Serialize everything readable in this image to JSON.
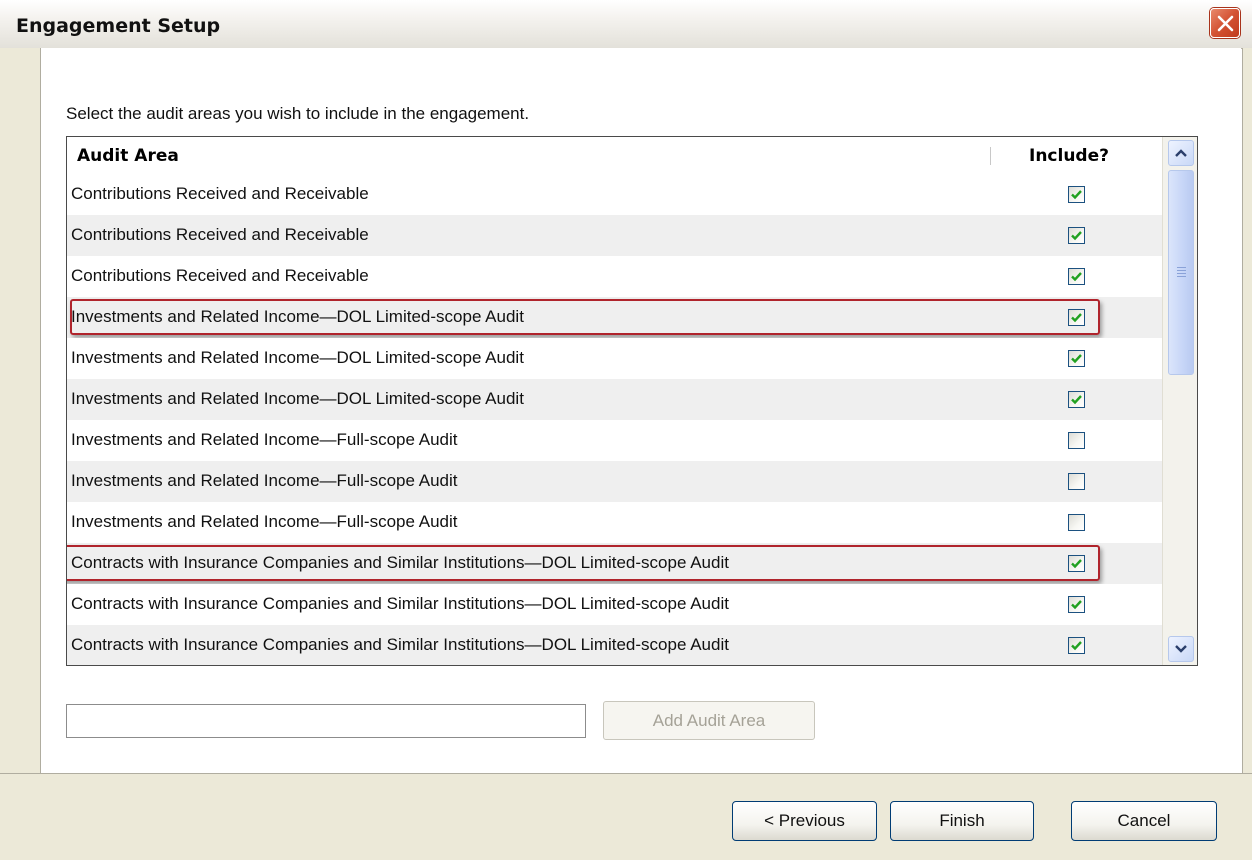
{
  "window": {
    "title": "Engagement Setup"
  },
  "instruction": "Select the audit areas you wish to include in the engagement.",
  "grid": {
    "columns": [
      "Audit Area",
      "Include?"
    ],
    "rows": [
      {
        "label": "Contributions Received and Receivable",
        "included": true
      },
      {
        "label": "Contributions Received and Receivable",
        "included": true
      },
      {
        "label": "Contributions Received and Receivable",
        "included": true
      },
      {
        "label": "Investments and Related Income—DOL Limited-scope Audit",
        "included": true,
        "highlighted": true
      },
      {
        "label": "Investments and Related Income—DOL Limited-scope Audit",
        "included": true
      },
      {
        "label": "Investments and Related Income—DOL Limited-scope Audit",
        "included": true
      },
      {
        "label": "Investments and Related Income—Full-scope Audit",
        "included": false
      },
      {
        "label": "Investments and Related Income—Full-scope Audit",
        "included": false
      },
      {
        "label": "Investments and Related Income—Full-scope Audit",
        "included": false
      },
      {
        "label": "Contracts with Insurance Companies and Similar Institutions—DOL Limited-scope Audit",
        "included": true,
        "highlighted": true
      },
      {
        "label": "Contracts with Insurance Companies and Similar Institutions—DOL Limited-scope Audit",
        "included": true
      },
      {
        "label": "Contracts with Insurance Companies and Similar Institutions—DOL Limited-scope Audit",
        "included": true
      }
    ]
  },
  "add_area": {
    "input_value": "",
    "button_label": "Add Audit Area"
  },
  "footer": {
    "previous_label": "< Previous",
    "finish_label": "Finish",
    "cancel_label": "Cancel"
  },
  "colors": {
    "highlight": "#b0242c",
    "checkmark": "#21a121",
    "row_alt": "#efefef"
  },
  "icons": {
    "close": "close-icon",
    "scroll_up": "chevron-up-icon",
    "scroll_down": "chevron-down-icon"
  }
}
